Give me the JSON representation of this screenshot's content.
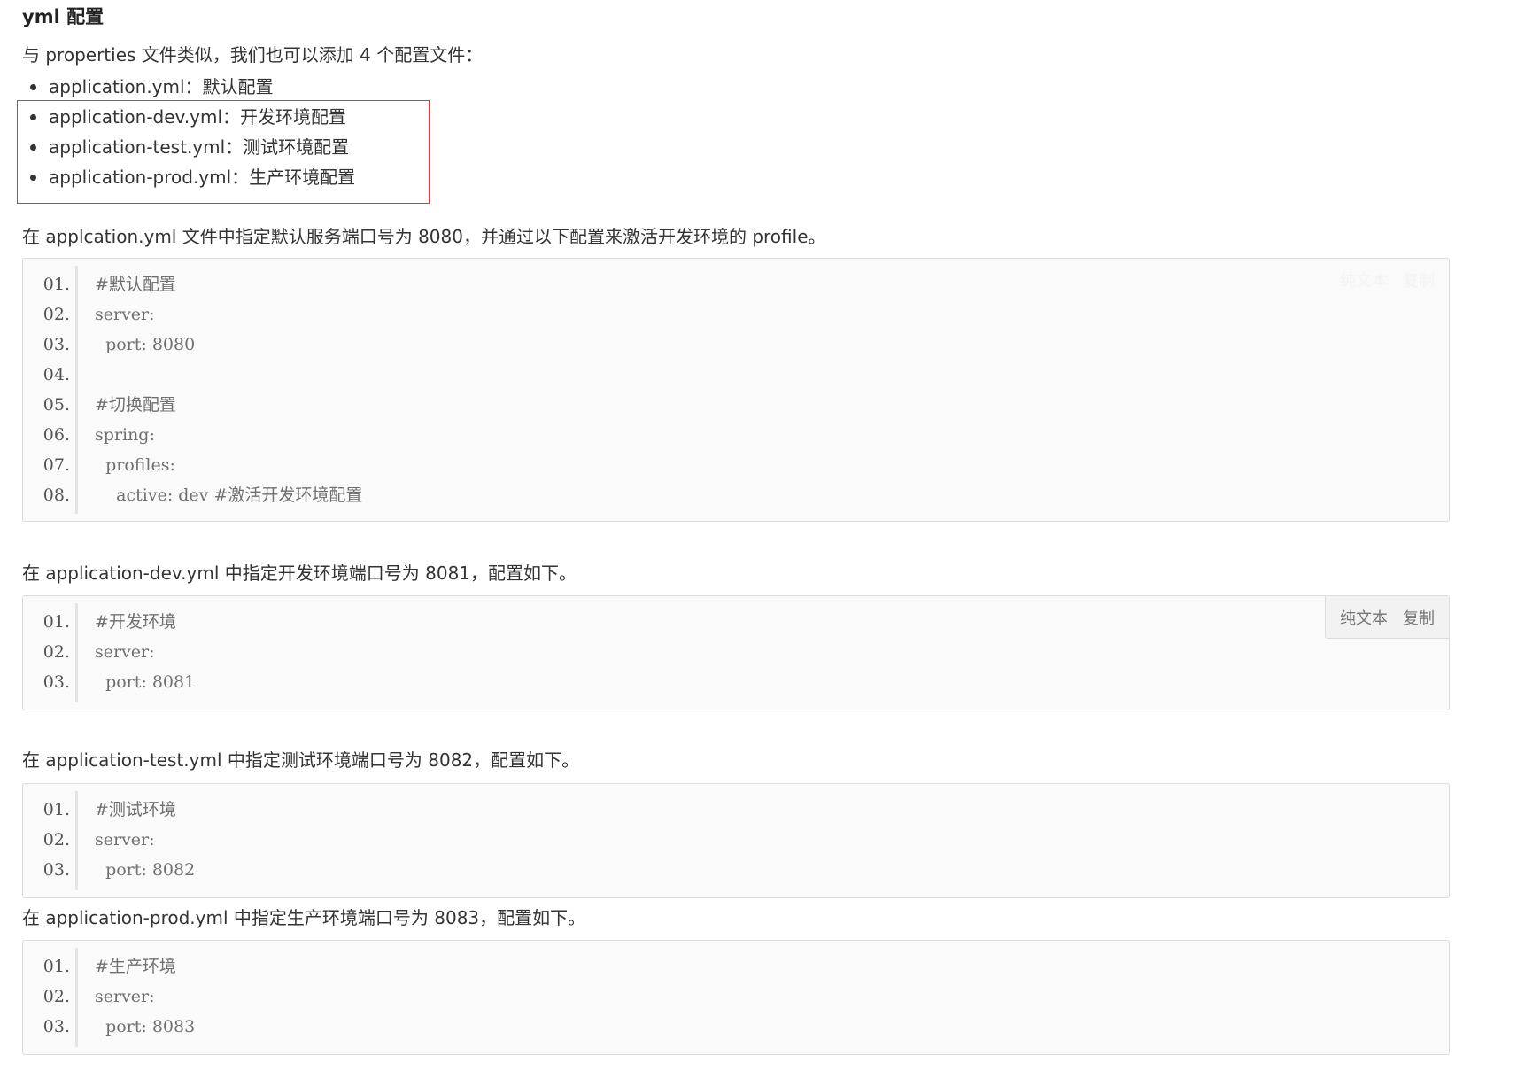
{
  "heading": "yml 配置",
  "intro": "与 properties 文件类似，我们也可以添加 4 个配置文件：",
  "files": [
    "application.yml：默认配置",
    "application-dev.yml：开发环境配置",
    "application-test.yml：测试环境配置",
    "application-prod.yml：生产环境配置"
  ],
  "sections": [
    {
      "text": "在 applcation.yml 文件中指定默认服务端口号为 8080，并通过以下配置来激活开发环境的 profile。",
      "toolbar": {
        "plain": "纯文本",
        "copy": "复制"
      },
      "lines": [
        {
          "num": "01.",
          "code": "#默认配置"
        },
        {
          "num": "02.",
          "code": "server:"
        },
        {
          "num": "03.",
          "code": "  port: 8080"
        },
        {
          "num": "04.",
          "code": ""
        },
        {
          "num": "05.",
          "code": "#切换配置"
        },
        {
          "num": "06.",
          "code": "spring:"
        },
        {
          "num": "07.",
          "code": "  profiles:"
        },
        {
          "num": "08.",
          "code": "    active: dev #激活开发环境配置"
        }
      ]
    },
    {
      "text": "在 application-dev.yml 中指定开发环境端口号为 8081，配置如下。",
      "toolbar": {
        "plain": "纯文本",
        "copy": "复制"
      },
      "lines": [
        {
          "num": "01.",
          "code": "#开发环境"
        },
        {
          "num": "02.",
          "code": "server:"
        },
        {
          "num": "03.",
          "code": "  port: 8081"
        }
      ]
    },
    {
      "text": "在 application-test.yml 中指定测试环境端口号为 8082，配置如下。",
      "lines": [
        {
          "num": "01.",
          "code": "#测试环境"
        },
        {
          "num": "02.",
          "code": "server:"
        },
        {
          "num": "03.",
          "code": "  port: 8082"
        }
      ]
    },
    {
      "text": "在 application-prod.yml 中指定生产环境端口号为 8083，配置如下。",
      "lines": [
        {
          "num": "01.",
          "code": "#生产环境"
        },
        {
          "num": "02.",
          "code": "server:"
        },
        {
          "num": "03.",
          "code": "  port: 8083"
        }
      ]
    }
  ],
  "colors": {
    "highlight_border": "#e0363c",
    "code_background": "#fafafa"
  }
}
